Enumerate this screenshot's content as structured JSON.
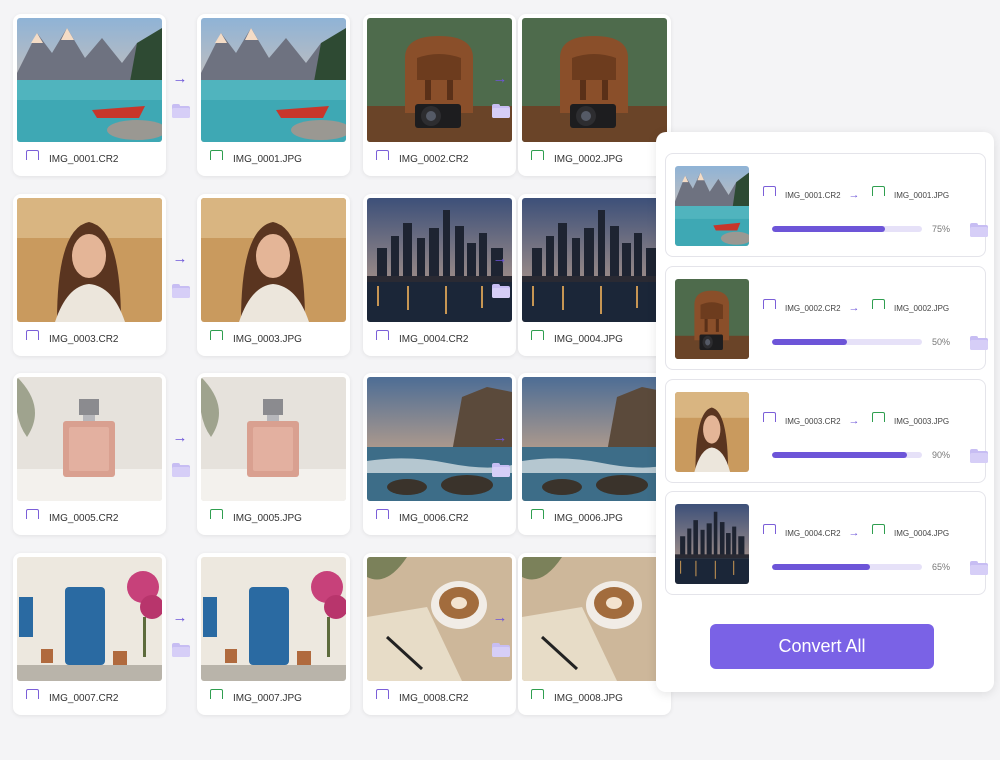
{
  "colors": {
    "accent": "#6d55d8",
    "button": "#7a62e6",
    "cr2_icon": "#7b5fd8",
    "jpg_icon": "#2f9e4f",
    "folder": "#c7bdf3"
  },
  "icons": {
    "arrow": "→",
    "cr2_tag": "CR2",
    "jpg_tag": "JPG"
  },
  "conversions": [
    {
      "source": "IMG_0001.CR2",
      "target": "IMG_0001.JPG",
      "image": "mountain-lake"
    },
    {
      "source": "IMG_0002.CR2",
      "target": "IMG_0002.JPG",
      "image": "leather-backpack"
    },
    {
      "source": "IMG_0003.CR2",
      "target": "IMG_0003.JPG",
      "image": "woman-portrait"
    },
    {
      "source": "IMG_0004.CR2",
      "target": "IMG_0004.JPG",
      "image": "city-skyline"
    },
    {
      "source": "IMG_0005.CR2",
      "target": "IMG_0005.JPG",
      "image": "perfume-bottle"
    },
    {
      "source": "IMG_0006.CR2",
      "target": "IMG_0006.JPG",
      "image": "rocky-coast"
    },
    {
      "source": "IMG_0007.CR2",
      "target": "IMG_0007.JPG",
      "image": "blue-door"
    },
    {
      "source": "IMG_0008.CR2",
      "target": "IMG_0008.JPG",
      "image": "latte-notebook"
    }
  ],
  "queue": [
    {
      "source": "IMG_0001.CR2",
      "target": "IMG_0001.JPG",
      "progress": 75,
      "progress_label": "75%",
      "image": "mountain-lake"
    },
    {
      "source": "IMG_0002.CR2",
      "target": "IMG_0002.JPG",
      "progress": 50,
      "progress_label": "50%",
      "image": "leather-backpack"
    },
    {
      "source": "IMG_0003.CR2",
      "target": "IMG_0003.JPG",
      "progress": 90,
      "progress_label": "90%",
      "image": "woman-portrait"
    },
    {
      "source": "IMG_0004.CR2",
      "target": "IMG_0004.JPG",
      "progress": 65,
      "progress_label": "65%",
      "image": "city-skyline"
    }
  ],
  "convert_all_label": "Convert All"
}
